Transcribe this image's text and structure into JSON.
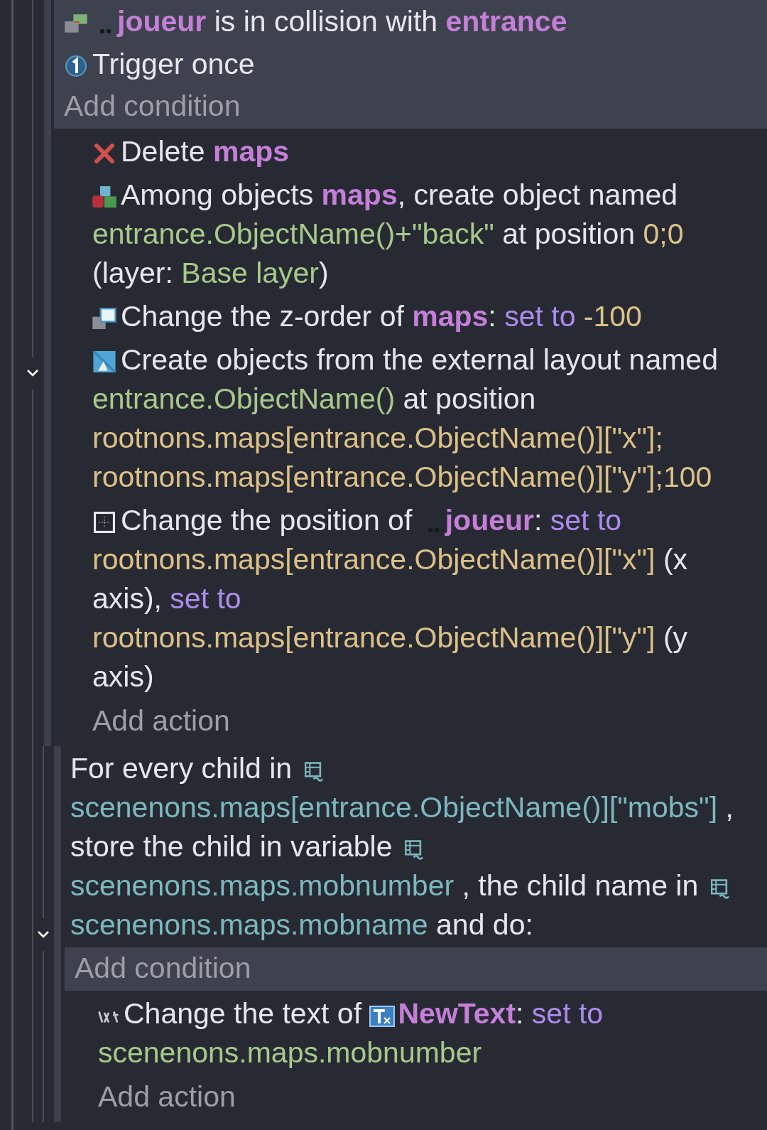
{
  "events": [
    {
      "kind": "standard",
      "expanded": true,
      "conditions": [
        {
          "kind": "collision",
          "segments": [
            {
              "kind": "sprite-object",
              "text": "joueur"
            },
            {
              "kind": "text",
              "text": " is in collision with "
            },
            {
              "kind": "object",
              "text": "entrance"
            }
          ]
        },
        {
          "kind": "trigger-once",
          "segments": [
            {
              "kind": "text",
              "text": "Trigger once"
            }
          ]
        }
      ],
      "add_condition": "Add condition",
      "actions": [
        {
          "kind": "delete",
          "segments": [
            {
              "kind": "text",
              "text": "Delete "
            },
            {
              "kind": "object",
              "text": "maps"
            }
          ]
        },
        {
          "kind": "create",
          "segments": [
            {
              "kind": "text",
              "text": "Among objects "
            },
            {
              "kind": "object",
              "text": "maps"
            },
            {
              "kind": "text",
              "text": ", create object named "
            },
            {
              "kind": "string-expr",
              "text": "entrance.ObjectName()+\"back\""
            },
            {
              "kind": "text",
              "text": " at position "
            },
            {
              "kind": "number-expr",
              "text": "0;0"
            },
            {
              "kind": "text",
              "text": " (layer: "
            },
            {
              "kind": "string-expr",
              "text": "Base layer"
            },
            {
              "kind": "text",
              "text": ")"
            }
          ]
        },
        {
          "kind": "z-order",
          "segments": [
            {
              "kind": "text",
              "text": "Change the z-order of "
            },
            {
              "kind": "object",
              "text": "maps"
            },
            {
              "kind": "text",
              "text": ": "
            },
            {
              "kind": "operator",
              "text": "set to "
            },
            {
              "kind": "number-expr",
              "text": "-100"
            }
          ]
        },
        {
          "kind": "external-layout",
          "segments": [
            {
              "kind": "text",
              "text": "Create objects from the external layout named "
            },
            {
              "kind": "string-expr",
              "text": "entrance.ObjectName()"
            },
            {
              "kind": "text",
              "text": " at position "
            },
            {
              "kind": "number-expr",
              "text": "rootnons.maps[entrance.ObjectName()][\"x\"];rootnons.maps[entrance.ObjectName()][\"y\"];100"
            }
          ]
        },
        {
          "kind": "position",
          "segments": [
            {
              "kind": "text",
              "text": "Change the position of "
            },
            {
              "kind": "sprite-object",
              "text": "joueur"
            },
            {
              "kind": "text",
              "text": ": "
            },
            {
              "kind": "operator",
              "text": "set to "
            },
            {
              "kind": "number-expr",
              "text": "rootnons.maps[entrance.ObjectName()][\"x\"]"
            },
            {
              "kind": "text",
              "text": " (x axis), "
            },
            {
              "kind": "operator",
              "text": "set to "
            },
            {
              "kind": "number-expr",
              "text": "rootnons.maps[entrance.ObjectName()][\"y\"]"
            },
            {
              "kind": "text",
              "text": " (y axis)"
            }
          ]
        }
      ],
      "add_action": "Add action",
      "children": [
        {
          "kind": "for-each-child",
          "expanded": true,
          "header": [
            {
              "kind": "text",
              "text": "For every child in "
            },
            {
              "kind": "variable",
              "text": "scenenons.maps[entrance.ObjectName()][\"mobs\"]"
            },
            {
              "kind": "text",
              "text": " , store the child in variable "
            },
            {
              "kind": "variable",
              "text": "scenenons.maps.mobnumber"
            },
            {
              "kind": "text",
              "text": " , the child name in "
            },
            {
              "kind": "variable",
              "text": "scenenons.maps.mobname"
            },
            {
              "kind": "text",
              "text": " and do:"
            }
          ],
          "add_condition": "Add condition",
          "actions": [
            {
              "kind": "text",
              "segments": [
                {
                  "kind": "text",
                  "text": "Change the text of "
                },
                {
                  "kind": "text-object",
                  "text": "NewText"
                },
                {
                  "kind": "text",
                  "text": ": "
                },
                {
                  "kind": "operator",
                  "text": "set to "
                },
                {
                  "kind": "string-expr",
                  "text": "scenenons.maps.mobnumber"
                }
              ]
            }
          ],
          "add_action": "Add action"
        }
      ]
    }
  ]
}
